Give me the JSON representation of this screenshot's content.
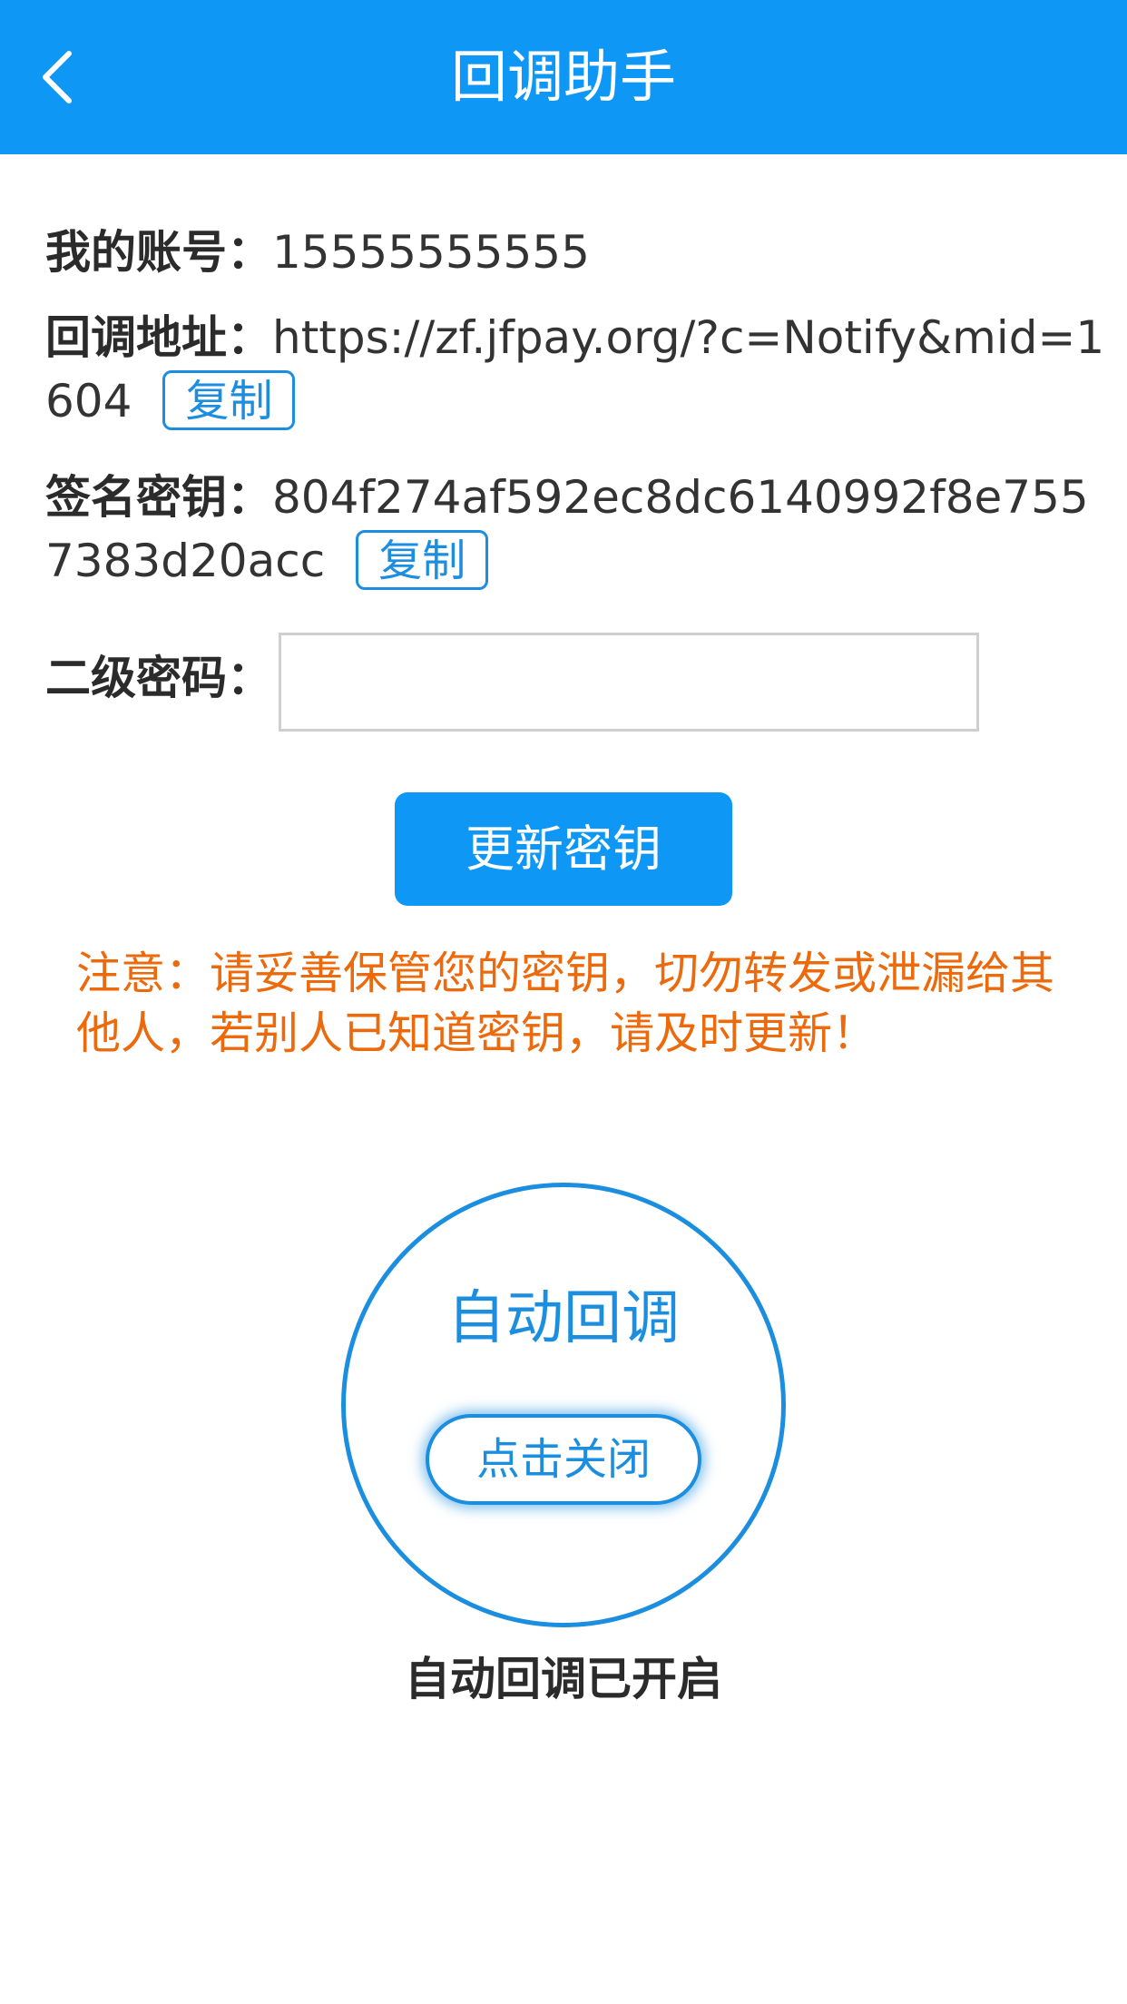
{
  "header": {
    "title": "回调助手"
  },
  "account": {
    "label": "我的账号：",
    "value": "15555555555"
  },
  "callback_url": {
    "label": "回调地址：",
    "value": "https://zf.jfpay.org/?c=Notify&mid=1604",
    "copy_label": "复制"
  },
  "sign_key": {
    "label": "签名密钥：",
    "value": "804f274af592ec8dc6140992f8e7557383d20acc",
    "copy_label": "复制"
  },
  "secondary_password": {
    "label": "二级密码：",
    "value": "",
    "placeholder": ""
  },
  "update_button": {
    "label": "更新密钥"
  },
  "notice": {
    "text": "注意：请妥善保管您的密钥，切勿转发或泄漏给其他人，若别人已知道密钥，请及时更新！"
  },
  "auto_callback": {
    "title": "自动回调",
    "toggle_label": "点击关闭",
    "status": "自动回调已开启"
  },
  "colors": {
    "primary": "#0e97f4",
    "accent_border": "#1b8ee0",
    "notice": "#ec6a0c",
    "text": "#333333"
  },
  "icons": {
    "back": "chevron-left-icon"
  }
}
